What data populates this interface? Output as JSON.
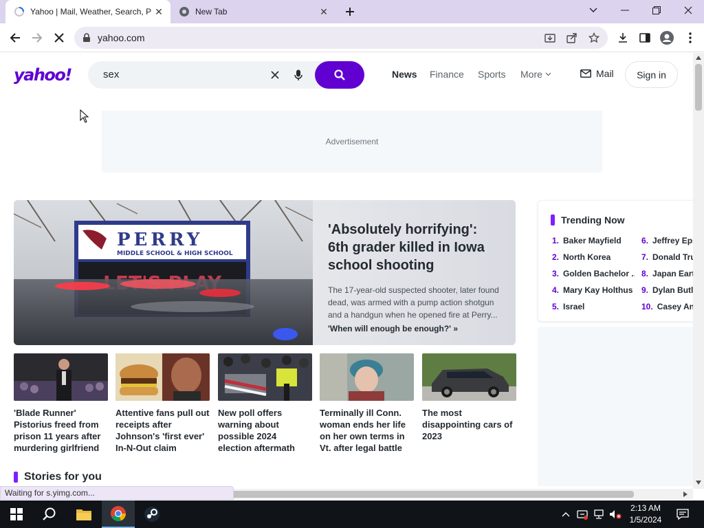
{
  "browser": {
    "tabs": [
      {
        "title": "Yahoo | Mail, Weather, Search, P",
        "active": true
      },
      {
        "title": "New Tab",
        "active": false
      }
    ],
    "url": "yahoo.com",
    "accent": "#dcd3ee"
  },
  "header": {
    "logo": "yahoo!",
    "search_query": "sex",
    "nav": [
      "News",
      "Finance",
      "Sports",
      "More"
    ],
    "mail": "Mail",
    "signin": "Sign in",
    "brand_color": "#6001d2"
  },
  "ad_label": "Advertisement",
  "hero": {
    "sign_line1": "PERRY",
    "sign_line2": "MIDDLE SCHOOL & HIGH SCHOOL",
    "sign_marquee": "LET'S PLAY",
    "title": "'Absolutely horrifying': 6th grader killed in Iowa school shooting",
    "description": "The 17-year-old suspected shooter, later found dead, was armed with a pump action shotgun and a handgun when he opened fire at Perry...",
    "link": "'When will enough be enough?' »"
  },
  "cards": [
    {
      "caption": "'Blade Runner' Pistorius freed from prison 11 years after murdering girlfriend"
    },
    {
      "caption": "Attentive fans pull out receipts after Johnson's 'first ever' In-N-Out claim"
    },
    {
      "caption": "New poll offers warning about possible 2024 election aftermath"
    },
    {
      "caption": "Terminally ill Conn. woman ends her life on her own terms in Vt. after legal battle"
    },
    {
      "caption": "The most disappointing cars of 2023"
    }
  ],
  "stories_heading": "Stories for you",
  "trending": {
    "title": "Trending Now",
    "items": [
      {
        "n": "1.",
        "label": "Baker Mayfield"
      },
      {
        "n": "2.",
        "label": "North Korea"
      },
      {
        "n": "3.",
        "label": "Golden Bachelor ..."
      },
      {
        "n": "4.",
        "label": "Mary Kay Holthus"
      },
      {
        "n": "5.",
        "label": "Israel"
      },
      {
        "n": "6.",
        "label": "Jeffrey Eps"
      },
      {
        "n": "7.",
        "label": "Donald Tru"
      },
      {
        "n": "8.",
        "label": "Japan Eart"
      },
      {
        "n": "9.",
        "label": "Dylan Butl"
      },
      {
        "n": "10.",
        "label": "Casey Ant"
      }
    ]
  },
  "status_text": "Waiting for s.yimg.com...",
  "taskbar": {
    "time": "2:13 AM",
    "date": "1/5/2024"
  }
}
